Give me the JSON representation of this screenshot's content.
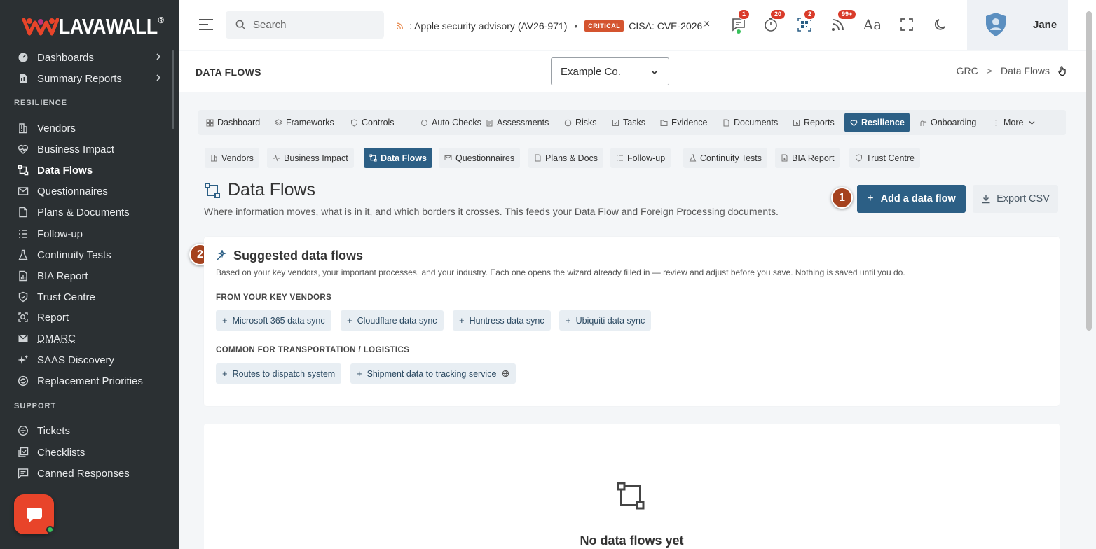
{
  "brand": {
    "name_part1": "LAVA",
    "name_part2": "WALL",
    "reg": "®"
  },
  "sidebar": {
    "items_top": [
      {
        "label": "Dashboards",
        "icon": "dashboard-icon",
        "has_arrow": true
      },
      {
        "label": "Summary Reports",
        "icon": "report-icon",
        "has_arrow": true
      }
    ],
    "section_resilience": "RESILIENCE",
    "items_resilience": [
      {
        "label": "Vendors",
        "icon": "building-icon"
      },
      {
        "label": "Business Impact",
        "icon": "heart-pulse-icon"
      },
      {
        "label": "Data Flows",
        "icon": "flow-icon",
        "active": true
      },
      {
        "label": "Questionnaires",
        "icon": "mail-icon"
      },
      {
        "label": "Plans & Documents",
        "icon": "document-icon"
      },
      {
        "label": "Follow-up",
        "icon": "list-icon"
      },
      {
        "label": "Continuity Tests",
        "icon": "flask-icon"
      },
      {
        "label": "BIA Report",
        "icon": "chart-icon"
      },
      {
        "label": "Trust Centre",
        "icon": "shield-icon"
      },
      {
        "label": "Report",
        "icon": "search-report-icon"
      },
      {
        "label": "DMARC",
        "icon": "mail-check-icon"
      },
      {
        "label": "SAAS Discovery",
        "icon": "sparkle-icon"
      },
      {
        "label": "Replacement Priorities",
        "icon": "refresh-icon"
      }
    ],
    "section_support": "SUPPORT",
    "items_support": [
      {
        "label": "Tickets",
        "icon": "ticket-icon"
      },
      {
        "label": "Checklists",
        "icon": "checklist-icon"
      },
      {
        "label": "Canned Responses",
        "icon": "message-icon"
      }
    ]
  },
  "topbar": {
    "search_placeholder": "Search",
    "ticker": {
      "item1": ": Apple security advisory (AV26-971)",
      "bullet": "•",
      "badge": "CRITICAL",
      "item2": "CISA: CVE-2026-",
      "close": "×"
    },
    "badges": {
      "messages": "1",
      "timer": "20",
      "qr": "2",
      "feeds": "99+"
    },
    "font_label": "Aa",
    "user_name": "Jane"
  },
  "page_header": {
    "title": "DATA FLOWS",
    "company": "Example Co.",
    "breadcrumb": [
      "GRC",
      "Data Flows"
    ],
    "breadcrumb_sep": ">"
  },
  "tabs_main": [
    {
      "label": "Dashboard"
    },
    {
      "label": "Frameworks"
    },
    {
      "label": "Controls"
    },
    {
      "label": "Auto Checks"
    },
    {
      "label": "Assessments"
    },
    {
      "label": "Risks"
    },
    {
      "label": "Tasks"
    },
    {
      "label": "Evidence"
    },
    {
      "label": "Documents"
    },
    {
      "label": "Reports"
    },
    {
      "label": "Resilience",
      "active": true
    },
    {
      "label": "Onboarding"
    },
    {
      "label": "More"
    }
  ],
  "tabs_sub": [
    {
      "label": "Vendors"
    },
    {
      "label": "Business Impact"
    },
    {
      "label": "Data Flows",
      "active": true
    },
    {
      "label": "Questionnaires"
    },
    {
      "label": "Plans & Docs"
    },
    {
      "label": "Follow-up"
    },
    {
      "label": "Continuity Tests"
    },
    {
      "label": "BIA Report"
    },
    {
      "label": "Trust Centre"
    }
  ],
  "main": {
    "title": "Data Flows",
    "subtitle": "Where information moves, what is in it, and which borders it crosses. This feeds your Data Flow and Foreign Processing documents.",
    "add_button": "Add a data flow",
    "export_button": "Export CSV",
    "step1": "1",
    "step2": "2"
  },
  "suggested": {
    "title": "Suggested data flows",
    "description": "Based on your key vendors, your important processes, and your industry. Each one opens the wizard already filled in — review and adjust before you save. Nothing is saved until you do.",
    "group1_label": "FROM YOUR KEY VENDORS",
    "group1_chips": [
      "Microsoft 365 data sync",
      "Cloudflare data sync",
      "Huntress data sync",
      "Ubiquiti data sync"
    ],
    "group2_label": "COMMON FOR TRANSPORTATION / LOGISTICS",
    "group2_chips": [
      "Routes to dispatch system",
      "Shipment data to tracking service"
    ]
  },
  "empty_state": {
    "title": "No data flows yet"
  },
  "colors": {
    "sidebar_bg": "#2b3033",
    "accent": "#2c5f85",
    "step_badge": "#a5421e",
    "critical": "#d4542f",
    "brand_red": "#e8442a"
  }
}
